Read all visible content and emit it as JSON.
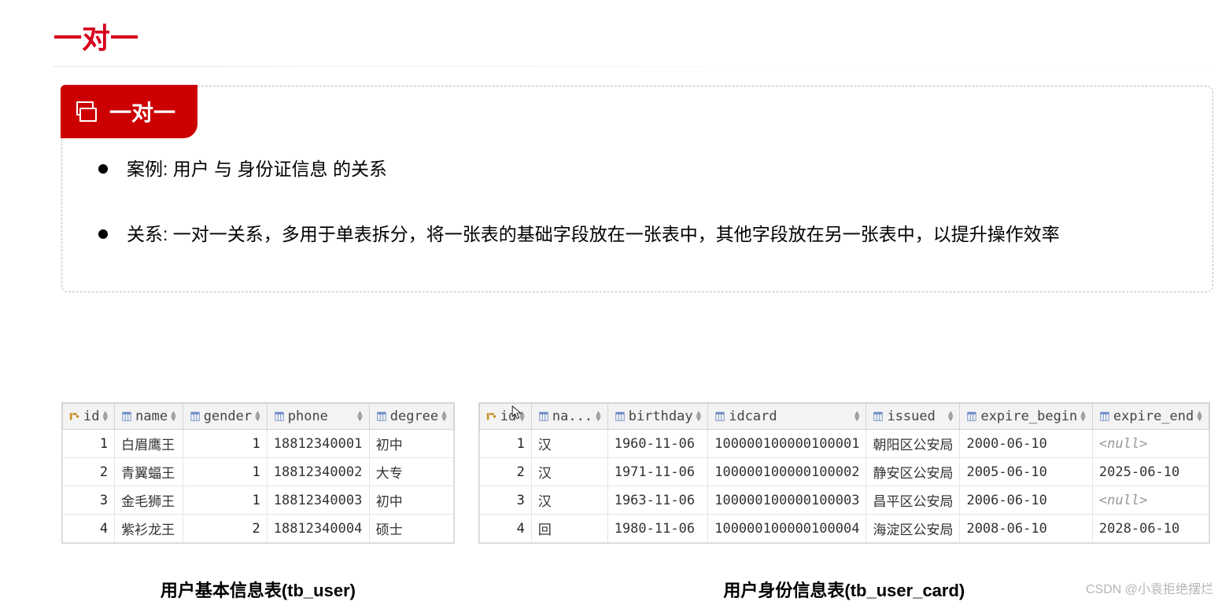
{
  "header": {
    "title": "一对一"
  },
  "badge": {
    "label": "一对一"
  },
  "bullets": [
    "案例: 用户 与 身份证信息 的关系",
    "关系: 一对一关系，多用于单表拆分，将一张表的基础字段放在一张表中，其他字段放在另一张表中，以提升操作效率"
  ],
  "table_user": {
    "caption": "用户基本信息表(tb_user)",
    "columns": [
      {
        "name": "id",
        "pk": true
      },
      {
        "name": "name",
        "pk": false
      },
      {
        "name": "gender",
        "pk": false
      },
      {
        "name": "phone",
        "pk": false
      },
      {
        "name": "degree",
        "pk": false
      }
    ],
    "rows": [
      {
        "id": "1",
        "name": "白眉鹰王",
        "gender": "1",
        "phone": "18812340001",
        "degree": "初中"
      },
      {
        "id": "2",
        "name": "青翼蝠王",
        "gender": "1",
        "phone": "18812340002",
        "degree": "大专"
      },
      {
        "id": "3",
        "name": "金毛狮王",
        "gender": "1",
        "phone": "18812340003",
        "degree": "初中"
      },
      {
        "id": "4",
        "name": "紫衫龙王",
        "gender": "2",
        "phone": "18812340004",
        "degree": "硕士"
      }
    ]
  },
  "table_card": {
    "caption": "用户身份信息表(tb_user_card)",
    "columns": [
      {
        "name": "id",
        "pk": true
      },
      {
        "name": "na...",
        "pk": false
      },
      {
        "name": "birthday",
        "pk": false
      },
      {
        "name": "idcard",
        "pk": false
      },
      {
        "name": "issued",
        "pk": false
      },
      {
        "name": "expire_begin",
        "pk": false
      },
      {
        "name": "expire_end",
        "pk": false
      }
    ],
    "rows": [
      {
        "id": "1",
        "na": "汉",
        "birthday": "1960-11-06",
        "idcard": "100000100000100001",
        "issued": "朝阳区公安局",
        "expire_begin": "2000-06-10",
        "expire_end": "<null>"
      },
      {
        "id": "2",
        "na": "汉",
        "birthday": "1971-11-06",
        "idcard": "100000100000100002",
        "issued": "静安区公安局",
        "expire_begin": "2005-06-10",
        "expire_end": "2025-06-10"
      },
      {
        "id": "3",
        "na": "汉",
        "birthday": "1963-11-06",
        "idcard": "100000100000100003",
        "issued": "昌平区公安局",
        "expire_begin": "2006-06-10",
        "expire_end": "<null>"
      },
      {
        "id": "4",
        "na": "回",
        "birthday": "1980-11-06",
        "idcard": "100000100000100004",
        "issued": "海淀区公安局",
        "expire_begin": "2008-06-10",
        "expire_end": "2028-06-10"
      }
    ]
  },
  "watermark": "CSDN @小袁拒绝摆烂"
}
